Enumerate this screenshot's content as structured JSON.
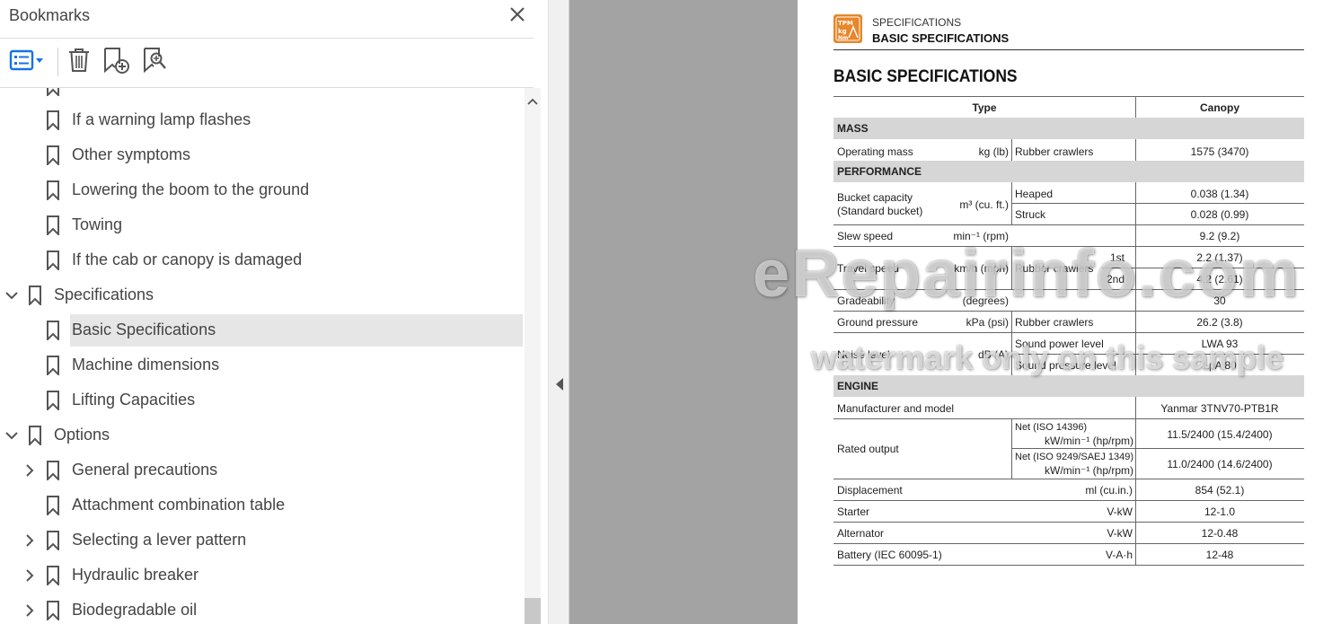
{
  "panel": {
    "title": "Bookmarks",
    "toolbar": {
      "options_icon": "list-options-icon",
      "delete_icon": "trash-icon",
      "add_icon": "bookmark-add-icon",
      "find_icon": "bookmark-search-icon"
    },
    "items": [
      {
        "label": "If a warning lamp flashes",
        "level": 2,
        "expander": "none"
      },
      {
        "label": "Other symptoms",
        "level": 2,
        "expander": "none"
      },
      {
        "label": "Lowering the boom to the ground",
        "level": 2,
        "expander": "none"
      },
      {
        "label": "Towing",
        "level": 2,
        "expander": "none"
      },
      {
        "label": "If the cab or canopy is damaged",
        "level": 2,
        "expander": "none"
      },
      {
        "label": "Specifications",
        "level": 1,
        "expander": "expanded"
      },
      {
        "label": "Basic Specifications",
        "level": 2,
        "expander": "none",
        "selected": true
      },
      {
        "label": "Machine dimensions",
        "level": 2,
        "expander": "none"
      },
      {
        "label": "Lifting Capacities",
        "level": 2,
        "expander": "none"
      },
      {
        "label": "Options",
        "level": 1,
        "expander": "expanded"
      },
      {
        "label": "General precautions",
        "level": 2,
        "expander": "collapsed"
      },
      {
        "label": "Attachment combination table",
        "level": 2,
        "expander": "none"
      },
      {
        "label": "Selecting a lever pattern",
        "level": 2,
        "expander": "collapsed"
      },
      {
        "label": "Hydraulic breaker",
        "level": 2,
        "expander": "collapsed"
      },
      {
        "label": "Biodegradable oil",
        "level": 2,
        "expander": "collapsed"
      }
    ]
  },
  "document": {
    "header_sub": "SPECIFICATIONS",
    "header_main": "BASIC SPECIFICATIONS",
    "title": "BASIC SPECIFICATIONS",
    "table": {
      "col_type": "Type",
      "col_canopy": "Canopy",
      "sections": {
        "mass": "MASS",
        "performance": "PERFORMANCE",
        "engine": "ENGINE"
      },
      "rows": {
        "operating_mass": {
          "label": "Operating mass",
          "unit": "kg (lb)",
          "sub": "Rubber crawlers",
          "value": "1575 (3470)"
        },
        "bucket": {
          "label1": "Bucket capacity",
          "label2": "(Standard bucket)",
          "unit": "m³ (cu. ft.)",
          "sub1": "Heaped",
          "value1": "0.038 (1.34)",
          "sub2": "Struck",
          "value2": "0.028 (0.99)"
        },
        "slew": {
          "label": "Slew speed",
          "unit": "min⁻¹ (rpm)",
          "value": "9.2 (9.2)"
        },
        "travel": {
          "label": "Travel speed",
          "unit": "km/h (mph)",
          "sub": "Rubber crawlers",
          "gear1": "1st",
          "value1": "2.2 (1.37)",
          "gear2": "2nd",
          "value2": "4.2 (2.61)"
        },
        "gradeability": {
          "label": "Gradeability",
          "unit": "(degrees)",
          "value": "30"
        },
        "ground": {
          "label": "Ground pressure",
          "unit": "kPa (psi)",
          "sub": "Rubber crawlers",
          "value": "26.2 (3.8)"
        },
        "noise": {
          "label": "Noise level",
          "unit": "dB (A)",
          "sub1": "Sound power level",
          "value1": "LWA 93",
          "sub2": "Sound pressure level",
          "value2": "LpA 80"
        },
        "manufacturer": {
          "label": "Manufacturer and model",
          "value": "Yanmar 3TNV70-PTB1R"
        },
        "rated": {
          "label": "Rated output",
          "sub1a": "Net (ISO 14396)",
          "sub1b": "kW/min⁻¹ (hp/rpm)",
          "value1": "11.5/2400 (15.4/2400)",
          "sub2a": "Net (ISO 9249/SAEJ 1349)",
          "sub2b": "kW/min⁻¹ (hp/rpm)",
          "value2": "11.0/2400 (14.6/2400)"
        },
        "displacement": {
          "label": "Displacement",
          "unit": "ml (cu.in.)",
          "value": "854 (52.1)"
        },
        "starter": {
          "label": "Starter",
          "unit": "V-kW",
          "value": "12-1.0"
        },
        "alternator": {
          "label": "Alternator",
          "unit": "V-kW",
          "value": "12-0.48"
        },
        "battery": {
          "label": "Battery (IEC 60095-1)",
          "unit": "V-A·h",
          "value": "12-48"
        }
      }
    },
    "watermark_main": "eRepairinfo.com",
    "watermark_sub": "watermark only on this sample"
  },
  "colors": {
    "accent_blue": "#1473e6",
    "logo_orange": "#e8862a",
    "selection": "#e6e6e6",
    "gray_area": "#a3a3a3"
  }
}
